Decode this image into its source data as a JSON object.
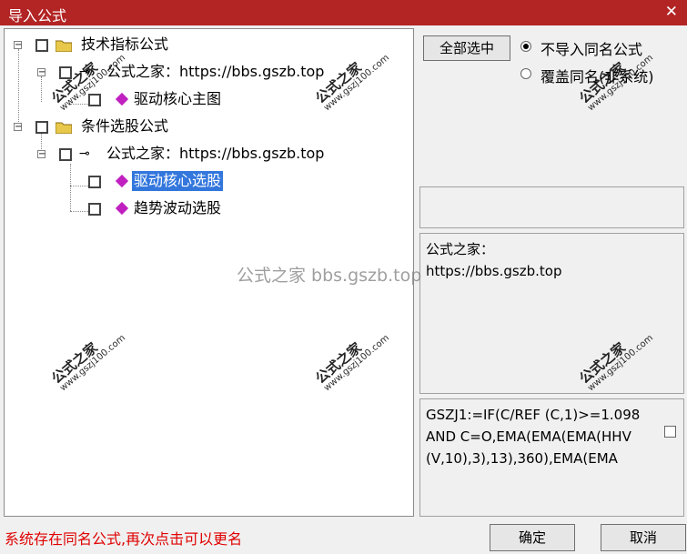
{
  "window": {
    "title": "导入公式",
    "close_label": "✕"
  },
  "tree": {
    "nodes": [
      {
        "label": "技术指标公式"
      },
      {
        "label": "公式之家：https://bbs.gszb.top"
      },
      {
        "label": "驱动核心主图"
      },
      {
        "label": "条件选股公式"
      },
      {
        "label": "公式之家：https://bbs.gszb.top"
      },
      {
        "label": "驱动核心选股"
      },
      {
        "label": "趋势波动选股"
      }
    ],
    "expand_glyph": "−"
  },
  "options": {
    "select_all": "全部选中",
    "radio_skip": "不导入同名公式",
    "radio_overwrite": "覆盖同名(非系统)"
  },
  "info": {
    "line1": "公式之家：",
    "line2": "https://bbs.gszb.top"
  },
  "formula": {
    "text": "GSZJ1:=IF(C/REF (C,1)>=1.098 AND C=O,EMA(EMA(EMA(HHV (V,10),3),13),360),EMA(EMA"
  },
  "status": {
    "message": "系统存在同名公式,再次点击可以更名"
  },
  "buttons": {
    "ok": "确定",
    "cancel": "取消"
  },
  "watermark": {
    "brand": "公式之家",
    "site": "www.gszj100.com",
    "center": "公式之家 bbs.gszb.top"
  }
}
